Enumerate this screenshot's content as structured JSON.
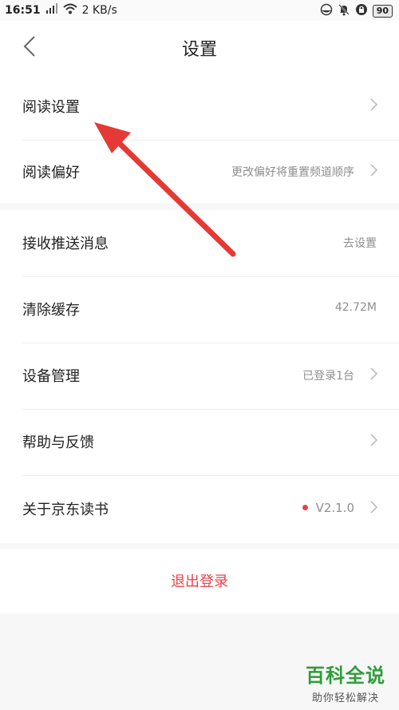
{
  "status_bar": {
    "time": "16:51",
    "network_speed": "2 KB/s",
    "battery": "90"
  },
  "header": {
    "title": "设置"
  },
  "settings": {
    "reading_settings": {
      "label": "阅读设置"
    },
    "reading_prefs": {
      "label": "阅读偏好",
      "value": "更改偏好将重置频道顺序"
    },
    "push_messages": {
      "label": "接收推送消息",
      "value": "去设置"
    },
    "clear_cache": {
      "label": "清除缓存",
      "value": "42.72M"
    },
    "device_mgmt": {
      "label": "设备管理",
      "value": "已登录1台"
    },
    "help_feedback": {
      "label": "帮助与反馈"
    },
    "about": {
      "label": "关于京东读书",
      "value": "V2.1.0"
    }
  },
  "logout": {
    "label": "退出登录"
  },
  "watermark": {
    "title": "百科全说",
    "subtitle": "助你轻松解决"
  },
  "colors": {
    "accent_red": "#e8424a",
    "annotation_arrow": "#e53935",
    "watermark_green": "#2e9d3a"
  }
}
